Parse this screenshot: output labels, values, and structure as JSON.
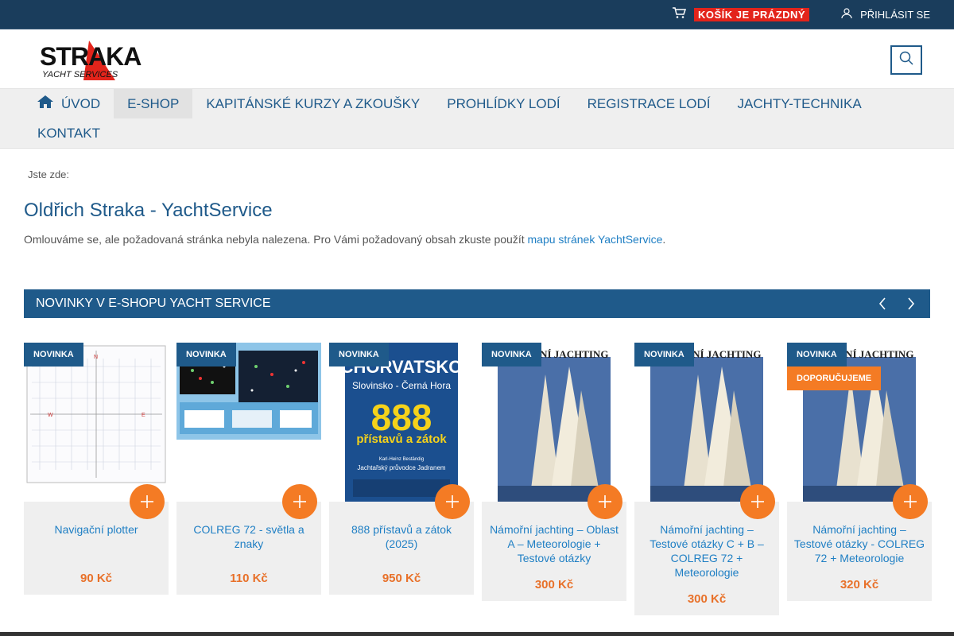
{
  "topbar": {
    "cart_label": "KOŠÍK JE PRÁZDNÝ",
    "login_label": "PŘIHLÁSIT SE",
    "cart_icon": "cart-icon",
    "user_icon": "user-icon"
  },
  "header": {
    "logo_text_main": "STRAKA",
    "logo_text_sub": "YACHT SERVICES",
    "search_icon": "search-icon"
  },
  "nav": {
    "items": [
      {
        "label": "ÚVOD",
        "icon": "home-icon"
      },
      {
        "label": "E-SHOP"
      },
      {
        "label": "KAPITÁNSKÉ KURZY A ZKOUŠKY"
      },
      {
        "label": "PROHLÍDKY LODÍ"
      },
      {
        "label": "REGISTRACE LODÍ"
      },
      {
        "label": "JACHTY-TECHNIKA"
      },
      {
        "label": "KONTAKT"
      }
    ]
  },
  "content": {
    "breadcrumb": "Jste zde:",
    "title": "Oldřich Straka - YachtService",
    "message_text": "Omlouváme se, ale požadovaná stránka nebyla nalezena. Pro Vámi požadovaný obsah zkuste použít",
    "message_link": "mapu stránek YachtService",
    "message_end": "."
  },
  "section": {
    "title": "NOVINKY V E-SHOPU YACHT SERVICE"
  },
  "products": [
    {
      "badge": "NOVINKA",
      "name": "Navigační plotter",
      "price": "90 Kč"
    },
    {
      "badge": "NOVINKA",
      "name": "COLREG 72 - světla a znaky",
      "price": "110 Kč"
    },
    {
      "badge": "NOVINKA",
      "name": "888 přístavů a zátok (2025)",
      "price": "950 Kč",
      "cover_title": "CHORVATSKO",
      "cover_sub": "Slovinsko - Černá Hora",
      "cover_num": "888",
      "cover_line": "přístavů a zátok",
      "cover_author": "Karl-Heinz Beständig",
      "cover_guide": "Jachtařský průvodce Jadranem"
    },
    {
      "badge": "NOVINKA",
      "name": "Námořní jachting – Oblast A – Meteorologie + Testové otázky",
      "price": "300 Kč",
      "cover_title": "NÁMOŘNÍ JACHTING"
    },
    {
      "badge": "NOVINKA",
      "name": "Námořní jachting – Testové otázky C + B – COLREG 72 + Meteorologie",
      "price": "300 Kč",
      "cover_title": "NÁMOŘNÍ JACHTING"
    },
    {
      "badge": "NOVINKA",
      "badge2": "DOPORUČUJEME",
      "name": "Námořní jachting – Testové otázky - COLREG 72 + Meteorologie",
      "price": "320 Kč",
      "cover_title": "NÁMOŘNÍ JACHTING"
    }
  ],
  "colors": {
    "topbar": "#1a3d5c",
    "primary": "#1f5a8a",
    "link": "#1f7fc4",
    "accent": "#f47b24",
    "cart_badge": "#e3241b"
  }
}
